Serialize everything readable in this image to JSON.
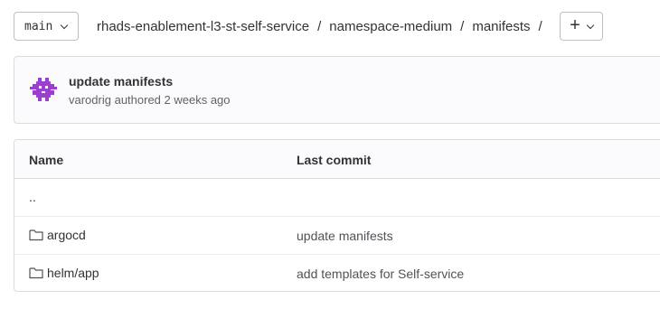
{
  "toolbar": {
    "branch": "main",
    "breadcrumb": [
      "rhads-enablement-l3-st-self-service",
      "namespace-medium",
      "manifests"
    ],
    "add_label": "+"
  },
  "last_commit": {
    "title": "update manifests",
    "author": "varodrig",
    "meta_suffix": "authored 2 weeks ago"
  },
  "table": {
    "headers": {
      "name": "Name",
      "last_commit": "Last commit"
    },
    "rows": [
      {
        "name": "..",
        "type": "parent",
        "commit": ""
      },
      {
        "name": "argocd",
        "type": "folder",
        "commit": "update manifests"
      },
      {
        "name": "helm/app",
        "type": "folder",
        "commit": "add templates for Self-service"
      }
    ]
  },
  "colors": {
    "avatar": "#9b3fd1",
    "text": "#333238",
    "muted": "#626168"
  }
}
